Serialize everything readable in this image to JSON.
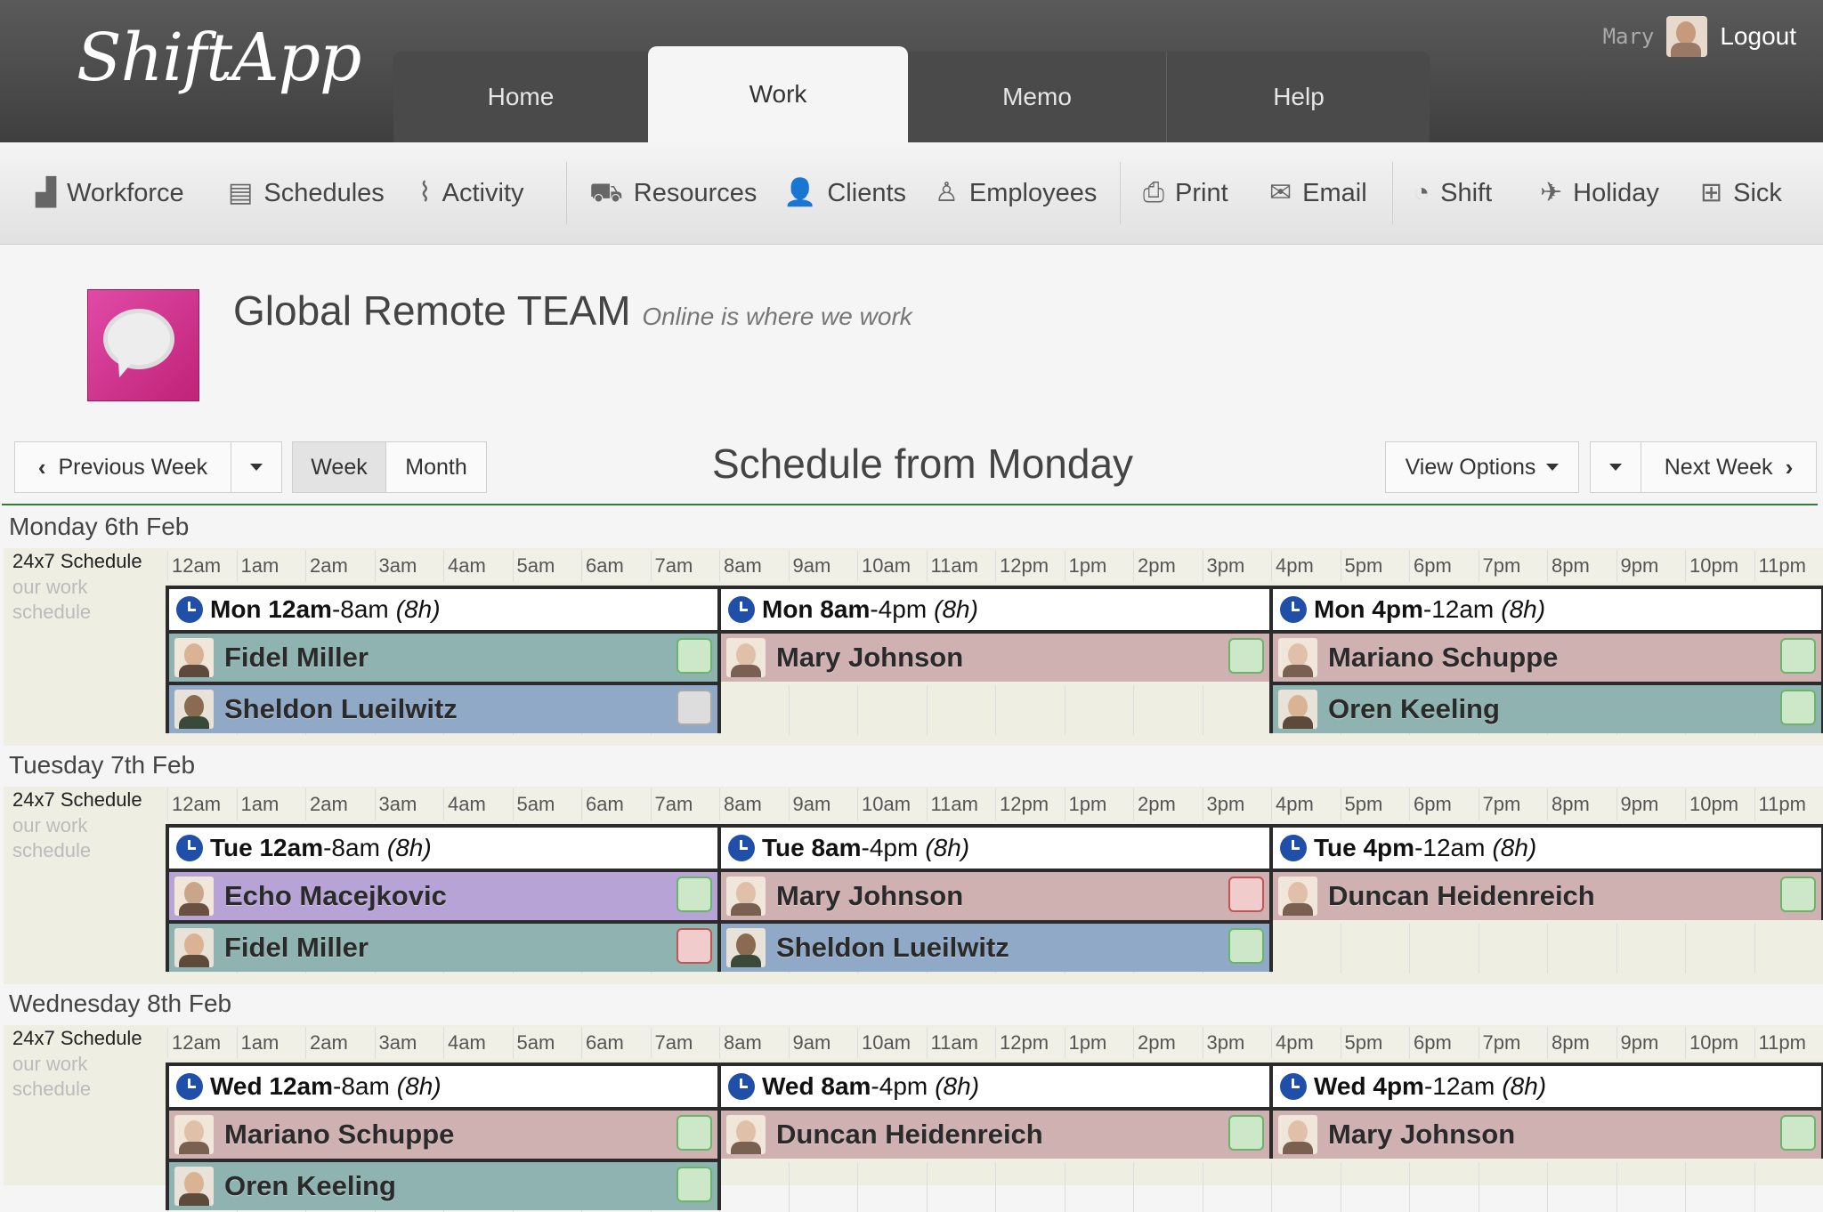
{
  "app": {
    "logo": "ShiftApp"
  },
  "nav": {
    "tabs": [
      {
        "label": "Home",
        "active": false
      },
      {
        "label": "Work",
        "active": true
      },
      {
        "label": "Memo",
        "active": false
      },
      {
        "label": "Help",
        "active": false
      }
    ]
  },
  "user": {
    "name": "Mary",
    "logout_label": "Logout"
  },
  "toolbar": {
    "items": [
      {
        "label": "Workforce",
        "icon": "factory-icon"
      },
      {
        "label": "Schedules",
        "icon": "clipboard-icon"
      },
      {
        "label": "Activity",
        "icon": "pulse-icon"
      },
      {
        "label": "Resources",
        "icon": "truck-icon"
      },
      {
        "label": "Clients",
        "icon": "user-group-icon"
      },
      {
        "label": "Employees",
        "icon": "user-outline-icon"
      },
      {
        "label": "Print",
        "icon": "printer-icon"
      },
      {
        "label": "Email",
        "icon": "envelope-icon"
      },
      {
        "label": "Shift",
        "icon": "clock-icon"
      },
      {
        "label": "Holiday",
        "icon": "plane-icon"
      },
      {
        "label": "Sick",
        "icon": "medkit-icon"
      }
    ]
  },
  "team": {
    "name": "Global Remote TEAM",
    "tagline": "Online is where we work"
  },
  "controls": {
    "previous_week": "Previous Week",
    "week": "Week",
    "month": "Month",
    "schedule_title": "Schedule from Monday",
    "view_options": "View Options",
    "next_week": "Next Week"
  },
  "hours": [
    "12am",
    "1am",
    "2am",
    "3am",
    "4am",
    "5am",
    "6am",
    "7am",
    "8am",
    "9am",
    "10am",
    "11am",
    "12pm",
    "1pm",
    "2pm",
    "3pm",
    "4pm",
    "5pm",
    "6pm",
    "7pm",
    "8pm",
    "9pm",
    "10pm",
    "11pm"
  ],
  "days": [
    {
      "title": "Monday 6th Feb",
      "schedule_label": "24x7 Schedule",
      "schedule_sub": "our work schedule",
      "shifts": [
        {
          "start": "Mon 12am",
          "end": "-8am",
          "dur": "(8h)",
          "employees": [
            {
              "name": "Fidel Miller",
              "color": "teal",
              "check": "g"
            },
            {
              "name": "Sheldon Lueilwitz",
              "color": "blue",
              "check": "w"
            }
          ]
        },
        {
          "start": "Mon 8am",
          "end": "-4pm",
          "dur": "(8h)",
          "employees": [
            {
              "name": "Mary Johnson",
              "color": "rose",
              "check": "g"
            }
          ]
        },
        {
          "start": "Mon 4pm",
          "end": "-12am",
          "dur": "(8h)",
          "employees": [
            {
              "name": "Mariano Schuppe",
              "color": "rose",
              "check": "g"
            },
            {
              "name": "Oren Keeling",
              "color": "teal",
              "check": "g"
            }
          ]
        }
      ]
    },
    {
      "title": "Tuesday 7th Feb",
      "schedule_label": "24x7 Schedule",
      "schedule_sub": "our work schedule",
      "shifts": [
        {
          "start": "Tue 12am",
          "end": "-8am",
          "dur": "(8h)",
          "employees": [
            {
              "name": "Echo Macejkovic",
              "color": "violet",
              "check": "g"
            },
            {
              "name": "Fidel Miller",
              "color": "teal",
              "check": "r"
            }
          ]
        },
        {
          "start": "Tue 8am",
          "end": "-4pm",
          "dur": "(8h)",
          "employees": [
            {
              "name": "Mary Johnson",
              "color": "rose",
              "check": "r"
            },
            {
              "name": "Sheldon Lueilwitz",
              "color": "blue",
              "check": "g"
            }
          ]
        },
        {
          "start": "Tue 4pm",
          "end": "-12am",
          "dur": "(8h)",
          "employees": [
            {
              "name": "Duncan Heidenreich",
              "color": "rose",
              "check": "g"
            }
          ]
        }
      ]
    },
    {
      "title": "Wednesday 8th Feb",
      "schedule_label": "24x7 Schedule",
      "schedule_sub": "our work schedule",
      "shifts": [
        {
          "start": "Wed 12am",
          "end": "-8am",
          "dur": "(8h)",
          "employees": [
            {
              "name": "Mariano Schuppe",
              "color": "rose",
              "check": "g"
            },
            {
              "name": "Oren Keeling",
              "color": "teal",
              "check": "g"
            }
          ]
        },
        {
          "start": "Wed 8am",
          "end": "-4pm",
          "dur": "(8h)",
          "employees": [
            {
              "name": "Duncan Heidenreich",
              "color": "rose",
              "check": "g"
            }
          ]
        },
        {
          "start": "Wed 4pm",
          "end": "-12am",
          "dur": "(8h)",
          "employees": [
            {
              "name": "Mary Johnson",
              "color": "rose",
              "check": "g"
            }
          ]
        }
      ]
    }
  ]
}
